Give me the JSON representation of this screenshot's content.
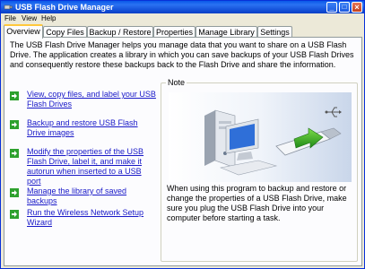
{
  "window": {
    "title": "USB Flash Drive Manager",
    "buttons": {
      "minimize": "_",
      "maximize": "□",
      "close": "×"
    }
  },
  "menu": [
    "File",
    "View",
    "Help"
  ],
  "tabs": [
    {
      "label": "Overview",
      "active": true
    },
    {
      "label": "Copy Files",
      "active": false
    },
    {
      "label": "Backup / Restore",
      "active": false
    },
    {
      "label": "Properties",
      "active": false
    },
    {
      "label": "Manage Library",
      "active": false
    },
    {
      "label": "Settings",
      "active": false
    }
  ],
  "overview": {
    "intro": "The USB Flash Drive Manager helps you manage data that you want to share on a USB Flash Drive. The application creates a library in which you can save backups of your USB Flash Drives and consequently restore these backups back to the Flash Drive and share the information.",
    "links": [
      {
        "label": "View, copy files, and label your USB Flash Drives",
        "icon": "green-arrow-icon"
      },
      {
        "label": "Backup and restore USB Flash Drive images",
        "icon": "green-arrow-icon"
      },
      {
        "label": "Modify the properties of the USB Flash Drive, label it, and make it autorun when inserted to a USB port",
        "icon": "green-arrow-icon"
      },
      {
        "label": "Manage the library of saved backups",
        "icon": "green-arrow-icon"
      },
      {
        "label": "Run the Wireless Network Setup Wizard",
        "icon": "green-arrow-icon"
      }
    ],
    "note": {
      "label": "Note",
      "text": "When using this program to backup and restore or change the properties of a USB Flash Drive, make sure you plug the USB Flash Drive into your computer before starting a task."
    }
  },
  "colors": {
    "titlebar": "#0a58e8",
    "link": "#1818c8",
    "arrow": "#2ea12e",
    "tab_highlight": "#ffc83c"
  }
}
